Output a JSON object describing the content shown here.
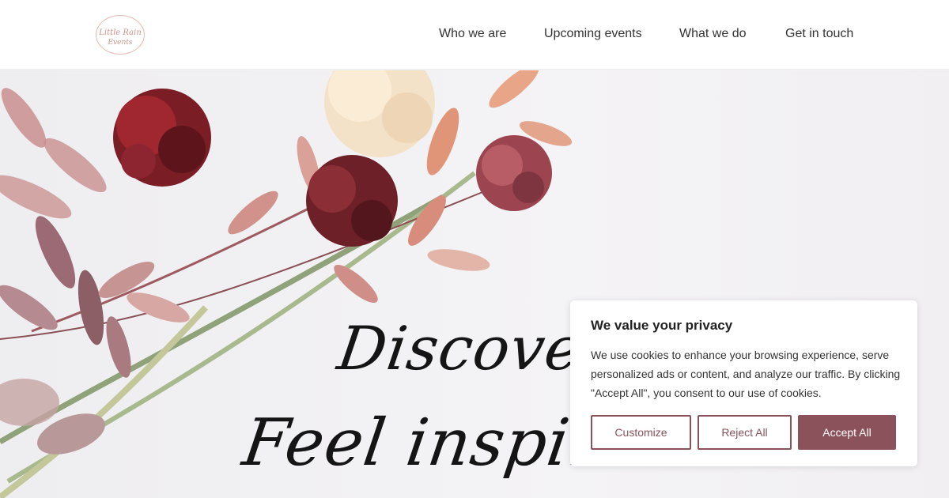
{
  "header": {
    "logo": {
      "line1": "Little Rain",
      "line2": "Events"
    },
    "nav": [
      {
        "label": "Who we are"
      },
      {
        "label": "Upcoming events"
      },
      {
        "label": "What we do"
      },
      {
        "label": "Get in touch"
      }
    ]
  },
  "hero": {
    "line1": "Discover",
    "line2": "Feel inspired"
  },
  "cookie_banner": {
    "title": "We value your privacy",
    "body": "We use cookies to enhance your browsing experience, serve personalized ads or content, and analyze our traffic. By clicking \"Accept All\", you consent to our use of cookies.",
    "buttons": {
      "customize": "Customize",
      "reject": "Reject All",
      "accept": "Accept All"
    }
  },
  "colors": {
    "accent": "#8b525b",
    "logo": "#c9948c",
    "background": "#f3f2f4"
  }
}
